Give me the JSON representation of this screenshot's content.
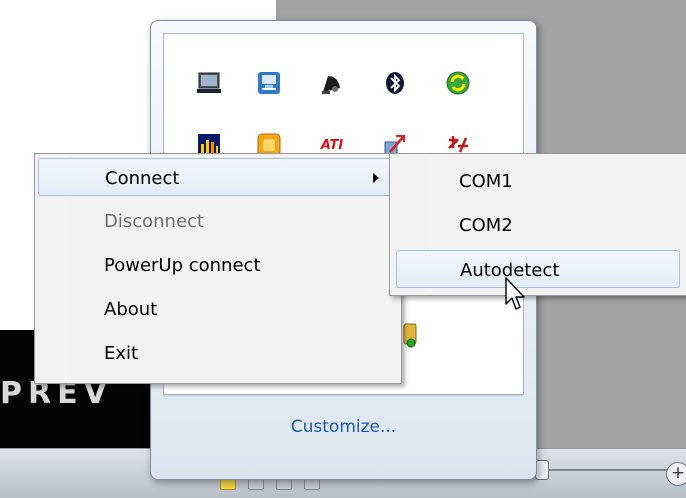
{
  "background": {
    "brand_text": "PREV"
  },
  "tray_flyout": {
    "icons": [
      "laptop-icon",
      "network-icon",
      "satellite-dish-icon",
      "bluetooth-icon",
      "sync-icon",
      "audio-equalizer-icon",
      "orange-app-icon",
      "ati-icon",
      "network-activity-icon",
      "language-icon",
      "powerup-device-icon"
    ],
    "ati_text": "ATI",
    "customize_label": "Customize..."
  },
  "context_menu": {
    "items": [
      {
        "label": "Connect",
        "has_submenu": true,
        "state": "hover"
      },
      {
        "label": "Disconnect",
        "state": "disabled"
      },
      {
        "label": "PowerUp connect",
        "state": "normal"
      },
      {
        "label": "About",
        "state": "normal"
      },
      {
        "label": "Exit",
        "state": "normal"
      }
    ]
  },
  "submenu": {
    "items": [
      {
        "label": "COM1",
        "state": "normal"
      },
      {
        "label": "COM2",
        "state": "normal"
      },
      {
        "label": "Autodetect",
        "state": "hover"
      }
    ]
  },
  "colors": {
    "menu_hover_border": "#a7c0e0",
    "link_blue": "#1f5aa5",
    "disabled_text": "#6d6d6d"
  }
}
